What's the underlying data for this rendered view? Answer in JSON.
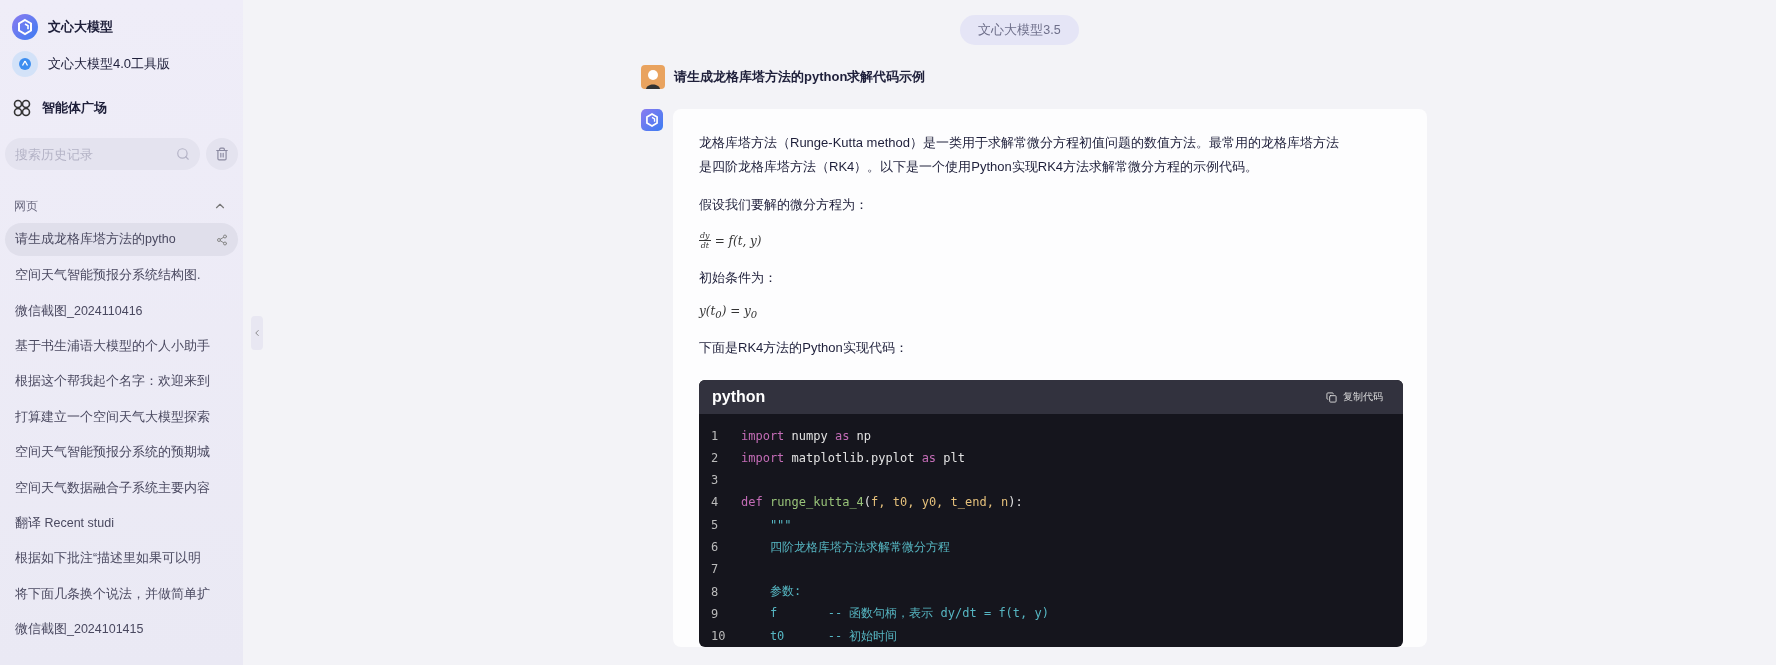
{
  "sidebar": {
    "brand": "文心大模型",
    "tool_version": "文心大模型4.0工具版",
    "agent_square": "智能体广场",
    "search": {
      "placeholder": "搜索历史记录"
    },
    "section": {
      "title": "网页",
      "expanded": true
    },
    "history": [
      {
        "title": "请生成龙格库塔方法的pytho",
        "selected": true
      },
      {
        "title": "空间天气智能预报分系统结构图.",
        "selected": false
      },
      {
        "title": "微信截图_2024110416",
        "selected": false
      },
      {
        "title": "基于书生浦语大模型的个人小助手",
        "selected": false
      },
      {
        "title": "根据这个帮我起个名字：欢迎来到",
        "selected": false
      },
      {
        "title": "打算建立一个空间天气大模型探索",
        "selected": false
      },
      {
        "title": "空间天气智能预报分系统的预期城",
        "selected": false
      },
      {
        "title": "空间天气数据融合子系统主要内容",
        "selected": false
      },
      {
        "title": "翻译 Recent studi",
        "selected": false
      },
      {
        "title": "根据如下批注“描述里如果可以明",
        "selected": false
      },
      {
        "title": "将下面几条换个说法，并做简单扩",
        "selected": false
      },
      {
        "title": "微信截图_2024101415",
        "selected": false
      }
    ]
  },
  "chat": {
    "model_badge": "文心大模型3.5",
    "question": "请生成龙格库塔方法的python求解代码示例",
    "answer": [
      {
        "kind": "paragraph",
        "text": "龙格库塔方法（Runge-Kutta method）是一类用于求解常微分方程初值问题的数值方法。最常用的龙格库塔方法是四阶龙格库塔方法（RK4）。以下是一个使用Python实现RK4方法求解常微分方程的示例代码。"
      },
      {
        "kind": "paragraph",
        "text": "假设我们要解的微分方程为："
      },
      {
        "kind": "fraction",
        "numerator": "dy",
        "denominator": "dt",
        "rest": "= f(t, y)"
      },
      {
        "kind": "paragraph",
        "text": "初始条件为："
      },
      {
        "kind": "equation",
        "text": "y(t$_{0}$) = y$_{0}$"
      },
      {
        "kind": "paragraph",
        "text": "下面是RK4方法的Python实现代码："
      },
      {
        "kind": "code",
        "language": "python",
        "copy_label": "复制代码",
        "lines": [
          {
            "number": "1",
            "tokens": [
              {
                "kind": "keyword",
                "text": "import"
              },
              {
                "kind": "plain",
                "text": " numpy "
              },
              {
                "kind": "keyword",
                "text": "as"
              },
              {
                "kind": "plain",
                "text": " np"
              }
            ]
          },
          {
            "number": "2",
            "tokens": [
              {
                "kind": "keyword",
                "text": "import"
              },
              {
                "kind": "plain",
                "text": " matplotlib.pyplot "
              },
              {
                "kind": "keyword",
                "text": "as"
              },
              {
                "kind": "plain",
                "text": " plt"
              }
            ]
          },
          {
            "number": "3"
          },
          {
            "number": "4",
            "tokens": [
              {
                "kind": "keyword",
                "text": "def"
              },
              {
                "kind": "function",
                "text": " runge_kutta_4"
              },
              {
                "kind": "plain",
                "text": "("
              },
              {
                "kind": "param",
                "text": "f, t0, y0, t_end, n"
              },
              {
                "kind": "plain",
                "text": "):"
              }
            ]
          },
          {
            "number": "5",
            "tokens": [
              {
                "kind": "doc",
                "text": "    \"\"\""
              }
            ]
          },
          {
            "number": "6",
            "tokens": [
              {
                "kind": "doc",
                "text": "    四阶龙格库塔方法求解常微分方程"
              }
            ]
          },
          {
            "number": "7"
          },
          {
            "number": "8",
            "tokens": [
              {
                "kind": "doc",
                "text": "    参数:"
              }
            ]
          },
          {
            "number": "9",
            "tokens": [
              {
                "kind": "doc",
                "text": "    f       -- 函数句柄，表示 dy/dt = f(t, y)"
              }
            ]
          },
          {
            "number": "10",
            "tokens": [
              {
                "kind": "doc",
                "text": "    t0      -- 初始时间"
              }
            ]
          }
        ]
      }
    ]
  }
}
